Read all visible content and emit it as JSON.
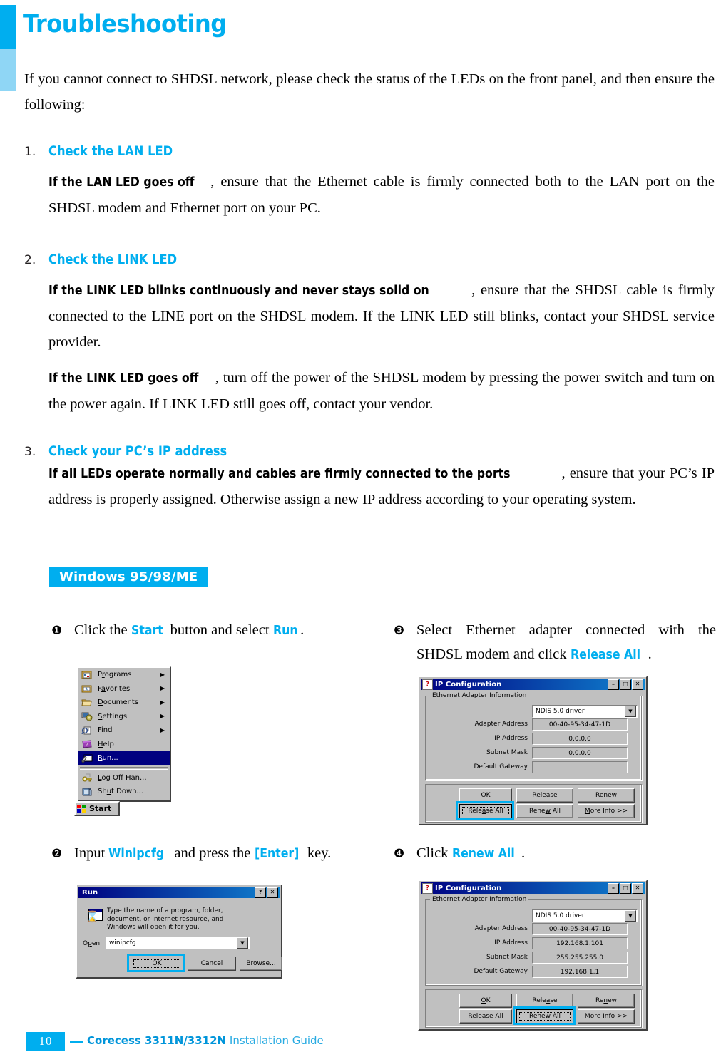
{
  "header": {
    "title": "Troubleshooting",
    "accent_color": "#00aeef",
    "accent_color_light": "#8fd6f5"
  },
  "intro": "If you cannot connect to SHDSL network, please check the status of the LEDs on the front panel, and then ensure the following:",
  "sections": [
    {
      "number": "1.",
      "heading": "Check the LAN LED",
      "lead": "If the LAN LED goes off",
      "body": ", ensure that the Ethernet cable is firmly connected both to the LAN port on the SHDSL modem and Ethernet port on your PC."
    },
    {
      "number": "2.",
      "heading": "Check the LINK LED",
      "lead": "If the LINK LED blinks continuously and never stays solid on",
      "body": ", ensure that the SHDSL cable is firmly connected to the LINE port on the SHDSL modem. If the LINK LED still blinks, contact your SHDSL service provider.",
      "lead2": "If the LINK LED goes off",
      "body2": ", turn off the power of the SHDSL modem by pressing the power switch and turn on the power again. If LINK LED still goes off, contact your vendor."
    },
    {
      "number": "3.",
      "heading": "Check your PC’s IP address",
      "lead": "If all LEDs operate normally and cables are firmly connected to the ports",
      "body": ", ensure that your PC’s IP address is properly assigned. Otherwise assign a new IP address according to your operating system."
    }
  ],
  "os_badge": "Windows 95/98/ME",
  "steps": [
    {
      "bullet": "❶",
      "t1": "Click the ",
      "hl1": "Start",
      "t2": " button and select ",
      "hl2": "Run",
      "t3": "."
    },
    {
      "bullet": "❷",
      "t1": "Input ",
      "hl1": "Winipcfg",
      "t2": " and press the ",
      "hl2": "[Enter]",
      "t3": " key."
    },
    {
      "bullet": "❸",
      "t1": "Select Ethernet adapter connected with the SHDSL modem and click ",
      "hl1": "Release All",
      "t2": "",
      "hl2": "",
      "t3": "."
    },
    {
      "bullet": "❹",
      "t1": "Click ",
      "hl1": "Renew All",
      "t2": "",
      "hl2": "",
      "t3": "."
    }
  ],
  "start_menu": {
    "items": [
      {
        "label_pre": "P",
        "label_u": "r",
        "label_post": "ograms",
        "icon": "programs-icon",
        "arrow": "▶",
        "selected": false
      },
      {
        "label_pre": "F",
        "label_u": "a",
        "label_post": "vorites",
        "icon": "favorites-icon",
        "arrow": "▶",
        "selected": false
      },
      {
        "label_pre": "",
        "label_u": "D",
        "label_post": "ocuments",
        "icon": "documents-icon",
        "arrow": "▶",
        "selected": false
      },
      {
        "label_pre": "",
        "label_u": "S",
        "label_post": "ettings",
        "icon": "settings-icon",
        "arrow": "▶",
        "selected": false
      },
      {
        "label_pre": "",
        "label_u": "F",
        "label_post": "ind",
        "icon": "find-icon",
        "arrow": "▶",
        "selected": false
      },
      {
        "label_pre": "",
        "label_u": "H",
        "label_post": "elp",
        "icon": "help-icon",
        "arrow": "",
        "selected": false
      },
      {
        "label_pre": "",
        "label_u": "R",
        "label_post": "un...",
        "icon": "run-icon",
        "arrow": "",
        "selected": true
      },
      {
        "label_pre": "",
        "label_u": "L",
        "label_post": "og Off Han...",
        "icon": "logoff-icon",
        "arrow": "",
        "selected": false
      },
      {
        "label_pre": "Sh",
        "label_u": "u",
        "label_post": "t Down...",
        "icon": "shutdown-icon",
        "arrow": "",
        "selected": false
      }
    ],
    "start_button": "Start"
  },
  "run_dialog": {
    "title": "Run",
    "help_btn": "?",
    "close_btn": "✕",
    "description": "Type the name of a program, folder, document, or Internet resource, and Windows will open it for you.",
    "open_label_pre": "O",
    "open_label_u": "p",
    "open_label_post": "en",
    "input_value": "winipcfg",
    "buttons": [
      {
        "pre": "",
        "u": "O",
        "post": "K",
        "focused": true
      },
      {
        "pre": "",
        "u": "C",
        "post": "ancel",
        "focused": false
      },
      {
        "pre": "",
        "u": "B",
        "post": "rowse...",
        "focused": false
      }
    ]
  },
  "ipconfig_top": {
    "title": "IP Configuration",
    "group_label": "Ethernet  Adapter Information",
    "adapter": "NDIS 5.0 driver",
    "fields": [
      {
        "label": "Adapter Address",
        "value": "00-40-95-34-47-1D"
      },
      {
        "label": "IP Address",
        "value": "0.0.0.0"
      },
      {
        "label": "Subnet Mask",
        "value": "0.0.0.0"
      },
      {
        "label": "Default Gateway",
        "value": ""
      }
    ],
    "buttons": [
      {
        "pre": "",
        "u": "O",
        "post": "K",
        "focused": false
      },
      {
        "pre": "Rele",
        "u": "a",
        "post": "se",
        "focused": false
      },
      {
        "pre": "Re",
        "u": "n",
        "post": "ew",
        "focused": false
      },
      {
        "pre": "Rele",
        "u": "a",
        "post": "se All",
        "focused": true
      },
      {
        "pre": "Rene",
        "u": "w",
        "post": " All",
        "focused": false
      },
      {
        "pre": "",
        "u": "M",
        "post": "ore Info >>",
        "focused": false
      }
    ],
    "minimize": "–",
    "maximize": "□",
    "close": "✕"
  },
  "ipconfig_bottom": {
    "title": "IP Configuration",
    "group_label": "Ethernet  Adapter Information",
    "adapter": "NDIS 5.0 driver",
    "fields": [
      {
        "label": "Adapter Address",
        "value": "00-40-95-34-47-1D"
      },
      {
        "label": "IP Address",
        "value": "192.168.1.101"
      },
      {
        "label": "Subnet Mask",
        "value": "255.255.255.0"
      },
      {
        "label": "Default Gateway",
        "value": "192.168.1.1"
      }
    ],
    "buttons": [
      {
        "pre": "",
        "u": "O",
        "post": "K",
        "focused": false
      },
      {
        "pre": "Rele",
        "u": "a",
        "post": "se",
        "focused": false
      },
      {
        "pre": "Re",
        "u": "n",
        "post": "ew",
        "focused": false
      },
      {
        "pre": "Rele",
        "u": "a",
        "post": "se All",
        "focused": false
      },
      {
        "pre": "Rene",
        "u": "w",
        "post": " All",
        "focused": true
      },
      {
        "pre": "",
        "u": "M",
        "post": "ore Info >>",
        "focused": false
      }
    ],
    "minimize": "–",
    "maximize": "□",
    "close": "✕"
  },
  "footer": {
    "page": "10",
    "brand": "Corecess 3311N/3312N",
    "doc": " Installation Guide"
  }
}
